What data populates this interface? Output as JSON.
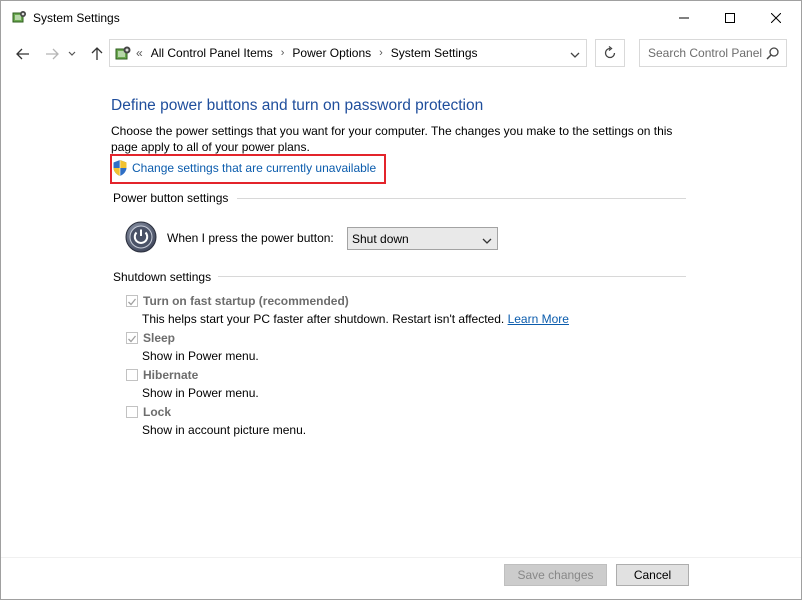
{
  "window": {
    "title": "System Settings"
  },
  "address_bar": {
    "overflow": "«",
    "crumbs": [
      "All Control Panel Items",
      "Power Options",
      "System Settings"
    ],
    "separator": "›"
  },
  "search": {
    "placeholder": "Search Control Panel"
  },
  "page": {
    "heading": "Define power buttons and turn on password protection",
    "description": "Choose the power settings that you want for your computer. The changes you make to the settings on this page apply to all of your power plans.",
    "change_link": "Change settings that are currently unavailable",
    "highlight_color": "#e3242b"
  },
  "power_section": {
    "title": "Power button settings",
    "label": "When I press the power button:",
    "selected": "Shut down"
  },
  "shutdown_section": {
    "title": "Shutdown settings",
    "items": [
      {
        "label": "Turn on fast startup (recommended)",
        "checked": true,
        "sub": "This helps start your PC faster after shutdown. Restart isn't affected.",
        "link": "Learn More"
      },
      {
        "label": "Sleep",
        "checked": true,
        "sub": "Show in Power menu."
      },
      {
        "label": "Hibernate",
        "checked": false,
        "sub": "Show in Power menu."
      },
      {
        "label": "Lock",
        "checked": false,
        "sub": "Show in account picture menu."
      }
    ]
  },
  "footer": {
    "save_label": "Save changes",
    "cancel_label": "Cancel"
  }
}
